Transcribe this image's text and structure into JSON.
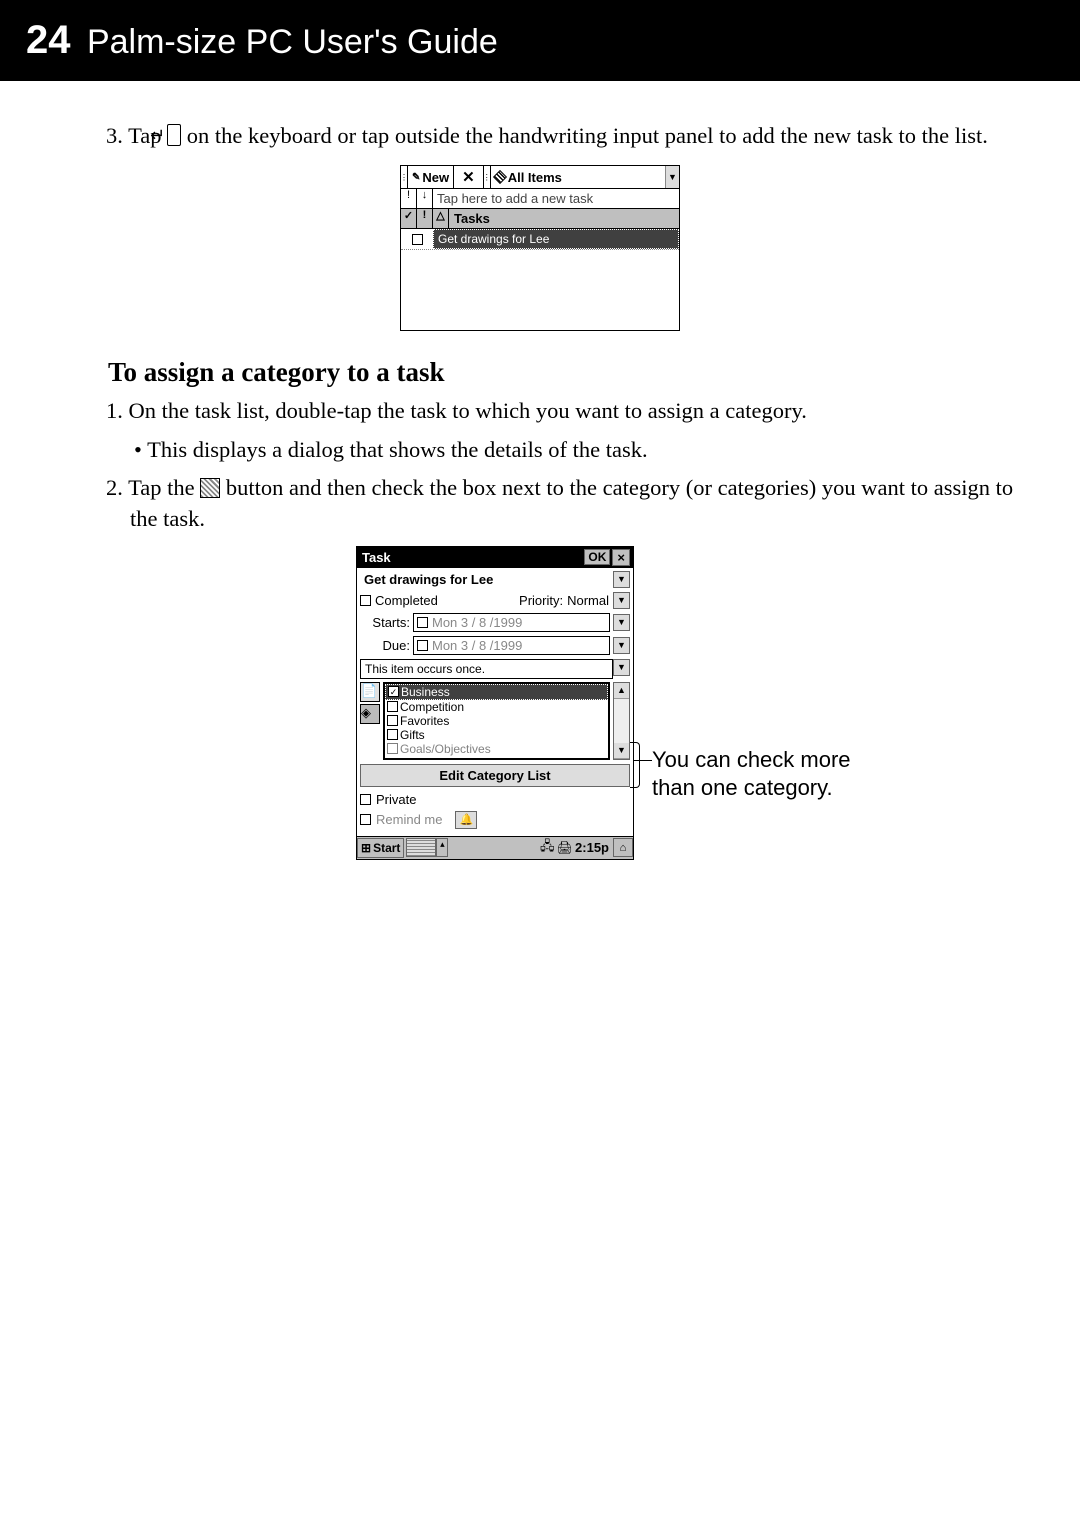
{
  "header": {
    "page_number": "24",
    "title": "Palm-size PC User's Guide"
  },
  "step3": {
    "num": "3.",
    "pre": "Tap ",
    "key": "↵",
    "post": " on the keyboard or tap outside the handwriting input panel to add the new task to the list."
  },
  "shot1": {
    "new_btn": "New",
    "all_items": "All Items",
    "input_placeholder": "Tap here to add a new task",
    "tasks_header": "Tasks",
    "task1": "Get drawings for Lee"
  },
  "section_title": "To assign a category to a task",
  "step1": {
    "num": "1.",
    "text": "On the task list, double-tap the task to which you want to assign a category."
  },
  "bullet1": "This displays a dialog that shows the details of the task.",
  "step2": {
    "num": "2.",
    "pre": "Tap the ",
    "post": " button and then check the box next to the category (or categories) you want to assign to the task."
  },
  "shot2": {
    "title": "Task",
    "ok": "OK",
    "close": "×",
    "task_name": "Get drawings for Lee",
    "completed": "Completed",
    "priority_label": "Priority:",
    "priority_value": "Normal",
    "starts_label": "Starts:",
    "starts_value": "Mon  3 / 8 /1999",
    "due_label": "Due:",
    "due_value": "Mon  3 / 8 /1999",
    "recurrence": "This item occurs once.",
    "categories": [
      "Business",
      "Competition",
      "Favorites",
      "Gifts",
      "Goals/Objectives"
    ],
    "selected_category_index": 0,
    "edit_cat": "Edit Category List",
    "private": "Private",
    "remind": "Remind me",
    "start": "Start",
    "time": "2:15p"
  },
  "annotation": {
    "line1": "You can check more",
    "line2": "than one category."
  }
}
